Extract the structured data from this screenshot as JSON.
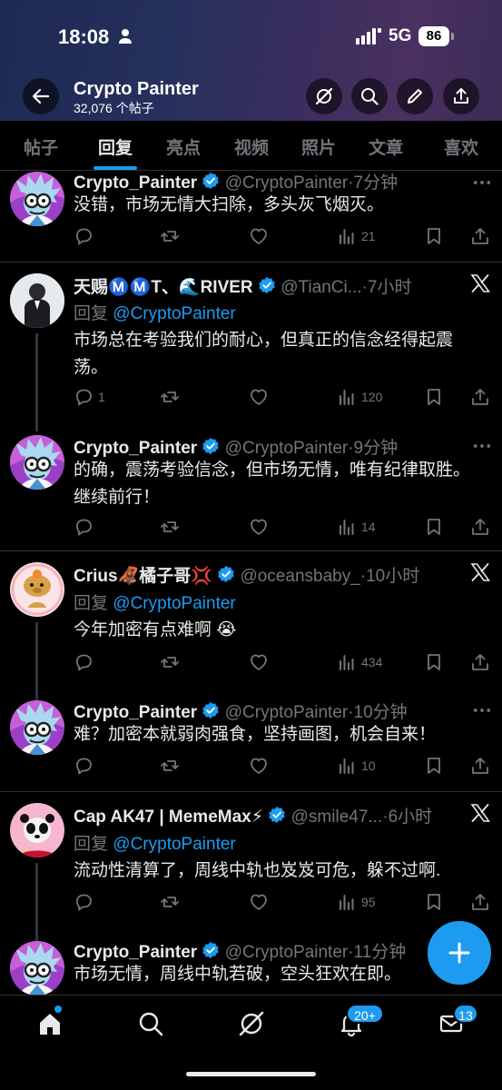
{
  "status_bar": {
    "time": "18:08",
    "network": "5G",
    "battery": "86"
  },
  "header": {
    "profile_name": "Crypto Painter",
    "post_count": "32,076 个帖子"
  },
  "tabs": [
    "帖子",
    "回复",
    "亮点",
    "视频",
    "照片",
    "文章",
    "喜欢"
  ],
  "active_tab": "回复",
  "tweets": [
    {
      "name": "Crypto_Painter",
      "handle": "@CryptoPainter",
      "time": "·7分钟",
      "text": "没错，市场无情大扫除，多头灰飞烟灭。",
      "views": "21"
    },
    {
      "name": "天赐Ⓜ️Ⓜ️T、🌊RIVER",
      "handle": "@TianCi...",
      "time": "·7小时",
      "reply_label": "回复",
      "reply_to": "@CryptoPainter",
      "text": "市场总在考验我们的耐心，但真正的信念经得起震荡。",
      "replies": "1",
      "views": "120"
    },
    {
      "name": "Crypto_Painter",
      "handle": "@CryptoPainter",
      "time": "·9分钟",
      "text": "的确，震荡考验信念，但市场无情，唯有纪律取胜。继续前行！",
      "views": "14"
    },
    {
      "name": "Crius🦧橘子哥💢",
      "handle": "@oceansbaby_",
      "time": "·10小时",
      "reply_label": "回复",
      "reply_to": "@CryptoPainter",
      "text": "今年加密有点难啊 😭",
      "views": "434"
    },
    {
      "name": "Crypto_Painter",
      "handle": "@CryptoPainter",
      "time": "·10分钟",
      "text": "难？加密本就弱肉强食，坚持画图，机会自来！",
      "views": "10"
    },
    {
      "name": "Cap AK47 | MemeMax⚡",
      "handle": "@smile47...",
      "time": "·6小时",
      "reply_label": "回复",
      "reply_to": "@CryptoPainter",
      "text": "流动性清算了，周线中轨也岌岌可危，躲不过啊.",
      "views": "95"
    },
    {
      "name": "Crypto_Painter",
      "handle": "@CryptoPainter",
      "time": "·11分钟",
      "text": "市场无情，周线中轨若破，空头狂欢在即。"
    }
  ],
  "nav": {
    "notifications_badge": "20+",
    "messages_badge": "13"
  },
  "colors": {
    "accent": "#1d9bf0",
    "background": "#000000",
    "muted": "#71767b"
  }
}
